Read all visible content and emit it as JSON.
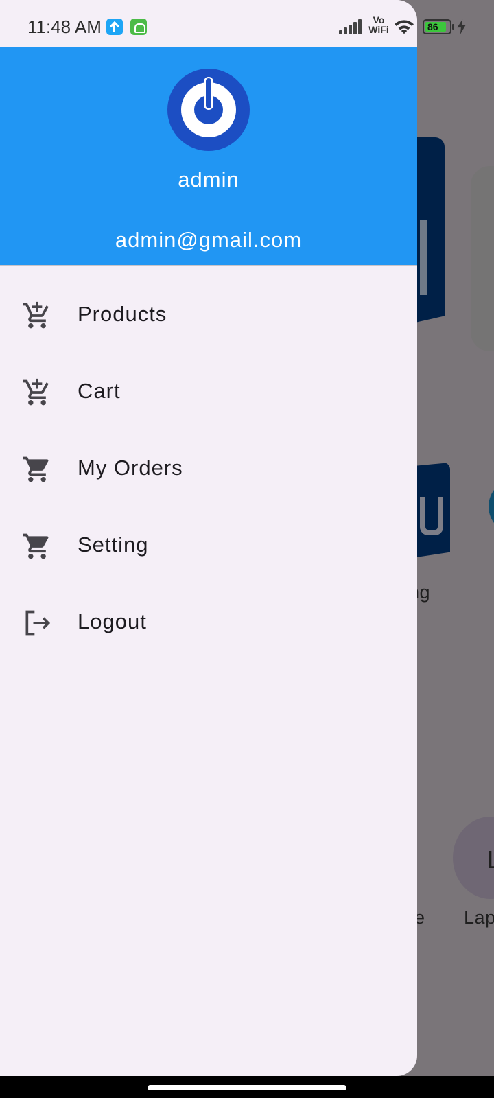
{
  "status_bar": {
    "time": "11:48 AM",
    "vowifi_top": "Vo",
    "vowifi_bottom": "WiFi",
    "battery": "86"
  },
  "background": {
    "text_ng": "ng",
    "text_e": "e",
    "text_lap": "Lap",
    "text_l": "L"
  },
  "drawer": {
    "header": {
      "name": "admin",
      "email": "admin@gmail.com",
      "color": "#2196f3"
    },
    "items": [
      {
        "label": "Products",
        "icon": "cart-products-icon"
      },
      {
        "label": "Cart",
        "icon": "cart-add-icon"
      },
      {
        "label": "My Orders",
        "icon": "cart-icon"
      },
      {
        "label": "Setting",
        "icon": "cart-icon"
      },
      {
        "label": "Logout",
        "icon": "logout-icon"
      }
    ]
  }
}
